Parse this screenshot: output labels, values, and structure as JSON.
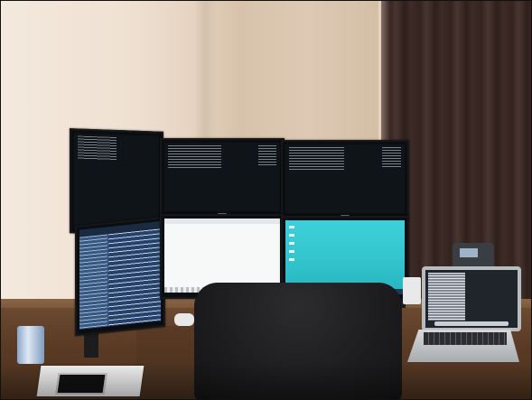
{
  "scene": {
    "subject": "multi-monitor-desk",
    "colors": {
      "wall": "#e6d4c1",
      "curtain": "#3d2a25",
      "desk": "#5a3b25",
      "chair": "#1c1c1e",
      "cyan_desktop": "#33c6cf",
      "white_window": "#f7f8f8",
      "ide_blue": "#2f4f7e",
      "terminal_bg": "#0e1418",
      "laptop_body": "#b9bcbf"
    },
    "monitors": [
      {
        "name": "top-left",
        "content": "terminal"
      },
      {
        "name": "top-center",
        "content": "terminal"
      },
      {
        "name": "top-right",
        "content": "terminal"
      },
      {
        "name": "bottom-left",
        "content": "ide"
      },
      {
        "name": "bottom-center",
        "content": "white-window"
      },
      {
        "name": "bottom-right",
        "content": "desktop-cyan"
      }
    ]
  }
}
